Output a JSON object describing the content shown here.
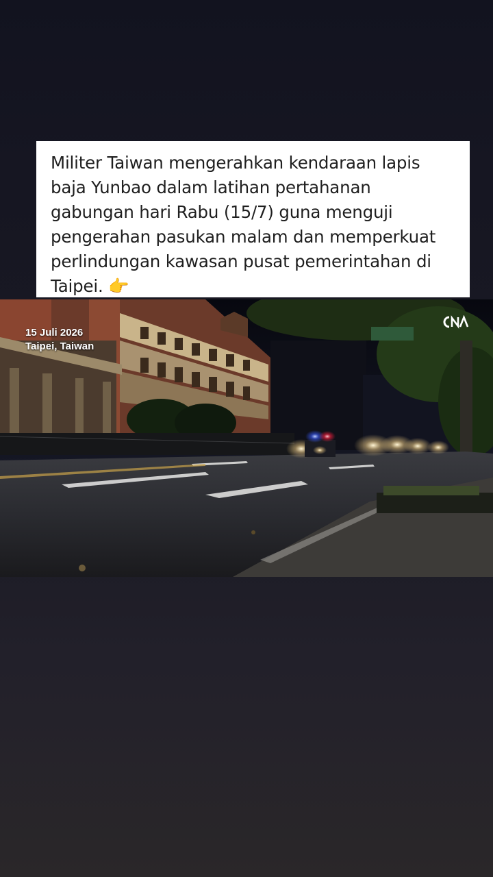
{
  "caption": {
    "text": "Militer Taiwan mengerahkan kendaraan lapis baja Yunbao dalam latihan pertahanan gabungan hari Rabu (15/7) guna menguji pengerahan pasukan malam dan memperkuat perlindungan kawasan pusat pemerintahan di Taipei. 👉"
  },
  "photo": {
    "date": "15 Juli 2026",
    "location": "Taipei, Taiwan",
    "logo_text": "CNA",
    "icon": "cna-logo"
  }
}
